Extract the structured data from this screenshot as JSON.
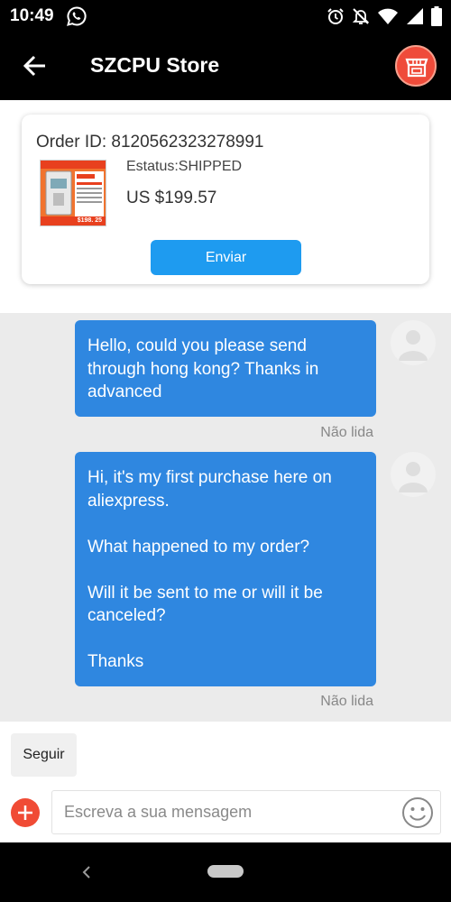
{
  "status_bar": {
    "time": "10:49"
  },
  "header": {
    "title": "SZCPU Store"
  },
  "order": {
    "id_text": "Order ID: 8120562323278991",
    "status_text": "Estatus:SHIPPED",
    "price_text": "US $199.57",
    "send_label": "Enviar",
    "thumb_price": "$198. 25"
  },
  "messages": [
    {
      "lines": [
        "Hello, could you please send through hong kong? Thanks in advanced"
      ],
      "read_status": "Não lida"
    },
    {
      "paragraphs": [
        "Hi, it's my first purchase here on aliexpress.",
        "What happened to my order?",
        "Will it be sent to me or will it be canceled?",
        "Thanks"
      ],
      "read_status": "Não lida"
    }
  ],
  "follow": {
    "label": "Seguir"
  },
  "composer": {
    "placeholder": "Escreva a sua mensagem"
  },
  "colors": {
    "accent_blue": "#1e9bf0",
    "bubble_blue": "#2f87e0",
    "brand_red": "#ef4b3a"
  },
  "icons": [
    "whatsapp-icon",
    "alarm-icon",
    "mute-icon",
    "wifi-icon",
    "signal-icon",
    "battery-icon",
    "back-arrow-icon",
    "store-icon",
    "avatar-icon",
    "plus-icon",
    "emoji-icon",
    "nav-back-icon"
  ]
}
